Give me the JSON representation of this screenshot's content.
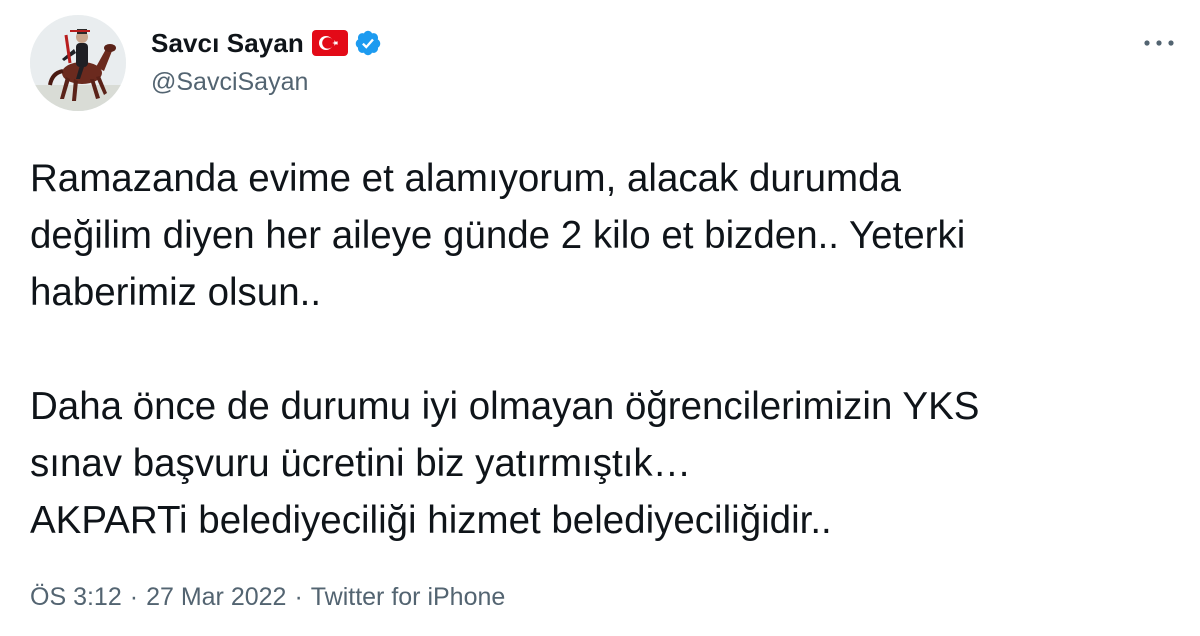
{
  "user": {
    "display_name": "Savcı Sayan",
    "handle": "@SavciSayan",
    "flag_icon": "turkey-flag-icon",
    "verified_icon": "verified-badge-icon",
    "verified_color": "#1d9bf0"
  },
  "more_icon": "more-horizontal-icon",
  "tweet": {
    "paragraph1": [
      "Ramazanda evime et alamıyorum, alacak durumda",
      "değilim diyen her aileye günde 2 kilo et bizden.. Yeterki",
      "haberimiz olsun.."
    ],
    "paragraph2": [
      "Daha önce de durumu iyi olmayan öğrencilerimizin YKS",
      "sınav başvuru ücretini biz yatırmıştık…",
      "AKPARTi belediyeciliği hizmet belediyeciliğidir.."
    ]
  },
  "meta": {
    "time": "ÖS 3:12",
    "separator": "·",
    "date": "27 Mar 2022",
    "source": "Twitter for iPhone"
  },
  "colors": {
    "text": "#0f1419",
    "secondary": "#536471",
    "flag_red": "#e30a17"
  }
}
